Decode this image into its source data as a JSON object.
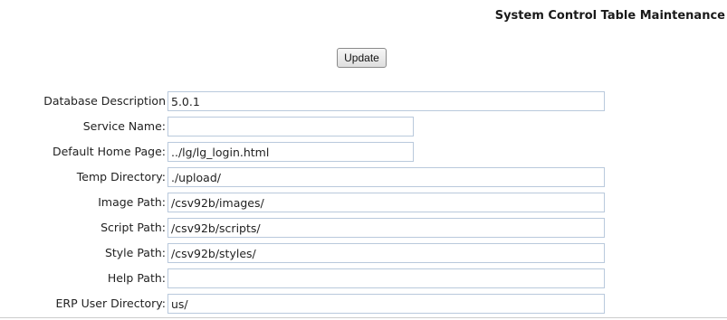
{
  "page": {
    "title": "System Control Table Maintenance"
  },
  "actions": {
    "update_label": "Update"
  },
  "fields": [
    {
      "label": "Database Description",
      "value": "5.0.1"
    },
    {
      "label": "Service Name:",
      "value": ""
    },
    {
      "label": "Default Home Page:",
      "value": "../lg/lg_login.html"
    },
    {
      "label": "Temp Directory:",
      "value": "./upload/"
    },
    {
      "label": "Image Path:",
      "value": "/csv92b/images/"
    },
    {
      "label": "Script Path:",
      "value": "/csv92b/scripts/"
    },
    {
      "label": "Style Path:",
      "value": "/csv92b/styles/"
    },
    {
      "label": "Help Path:",
      "value": ""
    },
    {
      "label": "ERP User Directory:",
      "value": "us/"
    }
  ]
}
